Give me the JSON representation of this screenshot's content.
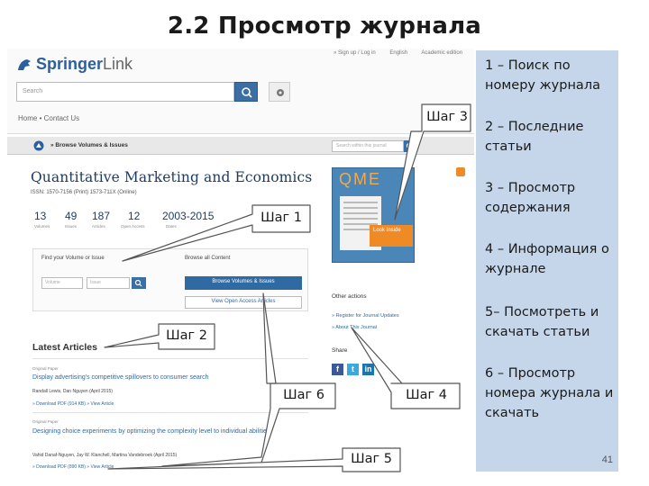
{
  "slide": {
    "title": "2.2 Просмотр журнала",
    "page_number": "41"
  },
  "notes": [
    "1 – Поиск по номеру журнала",
    "2 – Последние статьи",
    "3 – Просмотр содержания",
    "4 –  Информация о журнале",
    "5– Посмотреть и скачать статьи",
    "6 – Просмотр номера журнала и скачать"
  ],
  "steps": {
    "step1": "Шаг 1",
    "step2": "Шаг 2",
    "step3": "Шаг 3",
    "step4": "Шаг 4",
    "step5": "Шаг 5",
    "step6": "Шаг 6"
  },
  "springer": {
    "logo_brand": "Springer",
    "logo_suffix": "Link",
    "top_links": [
      "» Sign up / Log in",
      "English",
      "Academic edition"
    ],
    "search_placeholder": "Search",
    "breadcrumb": "Home  •  Contact Us"
  },
  "journal": {
    "bar_label": "» Browse Volumes & Issues",
    "bar_search_placeholder": "Search within this journal",
    "title": "Quantitative Marketing and Economics",
    "issn": "ISSN: 1570-7156 (Print) 1573-711X (Online)",
    "stats": [
      {
        "value": "13",
        "label": "Volumes"
      },
      {
        "value": "49",
        "label": "Issues"
      },
      {
        "value": "187",
        "label": "Articles"
      },
      {
        "value": "12",
        "label": "Open Access"
      },
      {
        "value": "2003-2015",
        "label": "Dates"
      }
    ],
    "cover_title": "QME",
    "look_inside": "Look Inside",
    "find_volume_label": "Find your Volume or Issue",
    "volume_placeholder": "Volume",
    "issue_placeholder": "Issue",
    "browse_all_label": "Browse all Content",
    "browse_volumes_btn": "Browse Volumes & Issues",
    "view_open_access_btn": "View Open Access Articles",
    "other_actions_label": "Other actions",
    "other_actions": [
      "» Register for Journal Updates",
      "» About This Journal"
    ],
    "share_label": "Share",
    "latest_label": "Latest Articles",
    "articles": [
      {
        "type": "Original Paper",
        "title": "Display advertising's competitive spillovers to consumer search",
        "authors": "Randall Lewis, Dan Nguyen (April 2015)",
        "links": "» Download PDF (914 KB)   » View Article"
      },
      {
        "type": "Original Paper",
        "title": "Designing choice experiments by optimizing the complexity level to individual abilities",
        "authors": "Vahid Danaf-Nguyen, Jay W. Klanchell, Martina Vandebroek (April 2015)",
        "links": "» Download PDF (890 KB)   » View Article"
      }
    ]
  },
  "colors": {
    "panel": "#c5d6ea",
    "springer_blue": "#2f6aa3",
    "cover_orange": "#f08a24"
  }
}
